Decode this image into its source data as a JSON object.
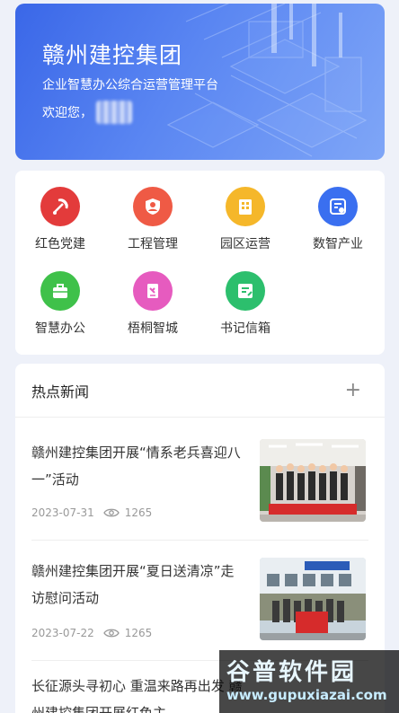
{
  "banner": {
    "title": "赣州建控集团",
    "subtitle": "企业智慧办公综合运营管理平台",
    "welcome": "欢迎您，"
  },
  "menu": {
    "items": [
      {
        "label": "红色党建",
        "icon": "party-emblem-icon",
        "color": "#e33b3b"
      },
      {
        "label": "工程管理",
        "icon": "shield-person-icon",
        "color": "#ef5a45"
      },
      {
        "label": "园区运营",
        "icon": "building-icon",
        "color": "#f5b72a"
      },
      {
        "label": "数智产业",
        "icon": "dashboard-icon",
        "color": "#3a6ff0"
      },
      {
        "label": "智慧办公",
        "icon": "briefcase-icon",
        "color": "#3fc14a"
      },
      {
        "label": "梧桐智城",
        "icon": "document-edit-icon",
        "color": "#e65bbf"
      },
      {
        "label": "书记信箱",
        "icon": "mailbox-edit-icon",
        "color": "#2cbf6d"
      }
    ]
  },
  "news": {
    "heading": "热点新闻",
    "plus": "+",
    "items": [
      {
        "title": "赣州建控集团开展“情系老兵喜迎八一”活动",
        "date": "2023-07-31",
        "views": "1265"
      },
      {
        "title": "赣州建控集团开展“夏日送清凉”走访慰问活动",
        "date": "2023-07-22",
        "views": "1265"
      },
      {
        "title": "长征源头寻初心 重温来路再出发 赣州建控集团开展红色主",
        "date": "",
        "views": ""
      }
    ]
  },
  "watermark": {
    "big": "谷普软件园",
    "small": "www.gupuxiazai.com"
  }
}
